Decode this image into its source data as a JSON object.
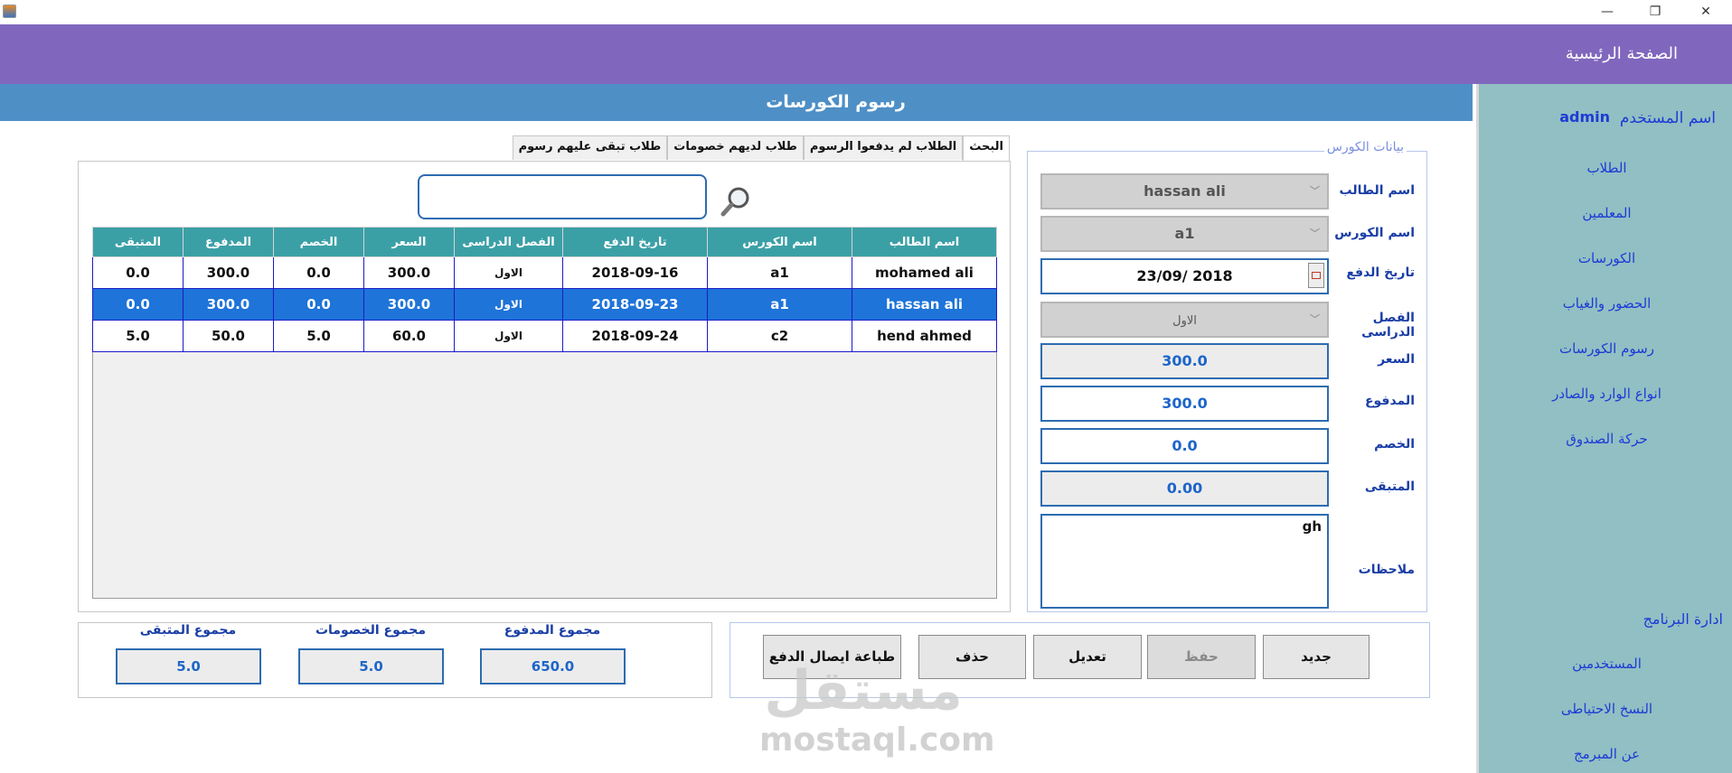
{
  "window": {
    "minimize": "—",
    "restore": "❐",
    "close": "✕"
  },
  "header": {
    "home_title": "الصفحة الرئيسية"
  },
  "page": {
    "title": "رسوم الكورسات"
  },
  "sidebar": {
    "user_label": "اسم المستخدم",
    "user_name": "admin",
    "items": [
      "الطلاب",
      "المعلمين",
      "الكورسات",
      "الحضور والغياب",
      "رسوم الكورسات",
      "انواع الوارد والصادر",
      "حركة الصندوق"
    ],
    "admin_title": "ادارة البرنامج",
    "admin_items": [
      "المستخدمين",
      "النسخ الاحتياطى",
      "عن المبرمج"
    ]
  },
  "form": {
    "legend": "بيانات الكورس",
    "labels": {
      "student": "اسم الطالب",
      "course": "اسم الكورس",
      "pay_date": "تاريخ الدفع",
      "semester": "الفصل الدراسى",
      "price": "السعر",
      "paid": "المدفوع",
      "discount": "الخصم",
      "remaining": "المتبقى",
      "notes": "ملاحظات"
    },
    "values": {
      "student": "hassan ali",
      "course": "a1",
      "pay_date": "23/09/ 2018",
      "semester": "الاول",
      "price": "300.0",
      "paid": "300.0",
      "discount": "0.0",
      "remaining": "0.00",
      "notes": "gh"
    }
  },
  "tabs": [
    "البحث",
    "الطلاب لم يدفعوا الرسوم",
    "طلاب لديهم خصومات",
    "طلاب تبقى عليهم رسوم"
  ],
  "search": {
    "value": ""
  },
  "table": {
    "headers": [
      "اسم الطالب",
      "اسم الكورس",
      "تاريخ الدفع",
      "الفصل الدراسى",
      "السعر",
      "الخصم",
      "المدفوع",
      "المتبقى"
    ],
    "rows": [
      [
        "mohamed ali",
        "a1",
        "2018-09-16",
        "الاول",
        "300.0",
        "0.0",
        "300.0",
        "0.0"
      ],
      [
        "hassan ali",
        "a1",
        "2018-09-23",
        "الاول",
        "300.0",
        "0.0",
        "300.0",
        "0.0"
      ],
      [
        "hend ahmed",
        "c2",
        "2018-09-24",
        "الاول",
        "60.0",
        "5.0",
        "50.0",
        "5.0"
      ]
    ]
  },
  "buttons": {
    "new": "جديد",
    "save": "حفظ",
    "edit": "تعديل",
    "delete": "حذف",
    "print": "طباعة ايصال الدفع"
  },
  "totals": {
    "paid_label": "مجموع المدفوع",
    "paid_value": "650.0",
    "discounts_label": "مجموع  الخصومات",
    "discounts_value": "5.0",
    "remaining_label": "مجموع المتبقى",
    "remaining_value": "5.0"
  },
  "watermark": {
    "logo": "مستقل",
    "text": "mostaql.com"
  },
  "colors": {
    "header": "#8067bd",
    "pagebar": "#4e8fc6",
    "sidebar": "#92bfc3",
    "table_header": "#3ba0a6",
    "selected_row": "#1e74d8"
  }
}
